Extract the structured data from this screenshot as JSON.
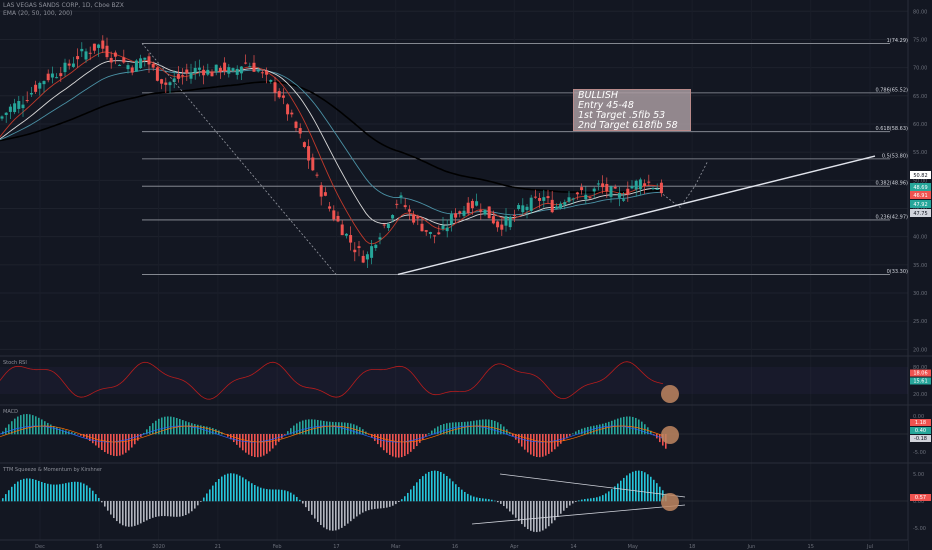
{
  "header": {
    "symbol_line": "LAS VEGAS SANDS CORP, 1D, Cboe BZX",
    "indicator_line": "EMA (20, 50, 100, 200)"
  },
  "note": {
    "lines": [
      "BULLISH",
      "Entry 45-48",
      "1st Target .5fib 53",
      "2nd Target 618fib 58"
    ]
  },
  "chart_data": [
    {
      "type": "line",
      "title": "",
      "subtype": "candlestick",
      "y_axis_ticks": [
        "80.00",
        "75.00",
        "70.00",
        "65.00",
        "60.00",
        "55.00",
        "50.00",
        "45.00",
        "40.00",
        "35.00",
        "30.00",
        "25.00",
        "20.00"
      ],
      "ylim": [
        19,
        82
      ],
      "x_axis_ticks": [
        "Dec",
        "16",
        "2020",
        "21",
        "Feb",
        "17",
        "Mar",
        "16",
        "Apr",
        "14",
        "May",
        "18",
        "Jun",
        "15",
        "Jul"
      ],
      "fibonacci_levels": [
        {
          "label": "1(74.29)",
          "value": 74.29
        },
        {
          "label": "0.786(65.52)",
          "value": 65.52
        },
        {
          "label": "0.618(58.63)",
          "value": 58.63
        },
        {
          "label": "0.5(53.80)",
          "value": 53.8
        },
        {
          "label": "0.382(48.96)",
          "value": 48.96
        },
        {
          "label": "0.236(42.97)",
          "value": 42.97
        },
        {
          "label": "0(33.30)",
          "value": 33.3
        }
      ],
      "price_badges": [
        {
          "label": "50.82",
          "color": "#ffffff",
          "text_color": "#131722"
        },
        {
          "label": "48.69",
          "color": "#26a69a",
          "text_color": "#ffffff"
        },
        {
          "label": "46.91",
          "color": "#ef5350",
          "text_color": "#ffffff"
        },
        {
          "label": "47.92",
          "color": "#26a69a",
          "text_color": "#ffffff"
        },
        {
          "label": "47.75",
          "color": "#d1d4dc",
          "text_color": "#131722"
        }
      ],
      "series": [
        {
          "name": "price",
          "values": [
            61,
            63,
            64,
            66,
            68,
            69,
            70,
            72,
            73,
            74,
            72,
            71,
            70,
            72,
            69,
            67,
            68,
            69,
            70,
            69,
            70,
            69,
            71,
            70,
            68,
            66,
            62,
            58,
            53,
            48,
            44,
            41,
            38,
            36,
            40,
            43,
            47,
            44,
            42,
            40,
            41,
            44,
            45,
            46,
            44,
            42,
            43,
            45,
            46,
            47,
            45,
            47,
            48,
            47,
            49,
            48,
            47,
            49,
            50,
            49,
            48
          ]
        }
      ],
      "annotations": [
        "support trendline",
        "projected path"
      ]
    },
    {
      "type": "line",
      "title": "Stoch RSI",
      "y_axis_ticks": [
        "80.00",
        "20.00"
      ],
      "badges": [
        "18.06",
        "15.61"
      ]
    },
    {
      "type": "bar",
      "title": "MACD",
      "y_axis_ticks": [
        "0.00",
        "-5.00"
      ],
      "badges": [
        "1.18",
        "0.40",
        "-0.18"
      ]
    },
    {
      "type": "bar",
      "title": "TTM Squeeze & Momentum by Kirshner",
      "y_axis_ticks": [
        "5.00",
        "0.00",
        "-5.00"
      ],
      "badges": [
        "0.57"
      ]
    }
  ]
}
